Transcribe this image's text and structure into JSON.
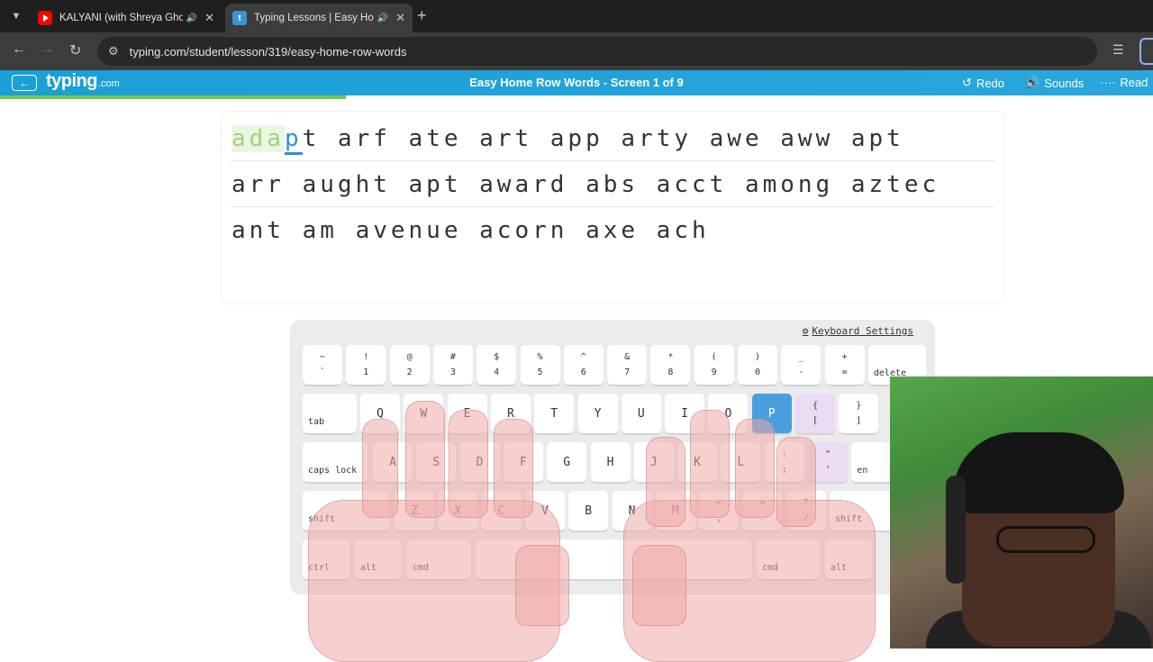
{
  "browser": {
    "tabs": [
      {
        "title": "KALYANI (with Shreya Ghoshal)",
        "favicon": "youtube-icon"
      },
      {
        "title": "Typing Lessons | Easy Home Row Words",
        "favicon": "typing-com-icon"
      }
    ],
    "url": "typing.com/student/lesson/319/easy-home-row-words"
  },
  "header": {
    "logo": "typing",
    "logo_suffix": ".com",
    "title": "Easy Home Row Words - Screen 1 of 9",
    "actions": [
      "Redo",
      "Sounds",
      "Read"
    ],
    "progress_fraction": 0.3
  },
  "lesson": {
    "typed": "ada",
    "current": "p",
    "line1_rest": "t arf ate art app arty awe aww apt",
    "line2": "arr aught apt award abs acct among aztec",
    "line3": "ant am avenue acorn axe ach"
  },
  "keyboard": {
    "settings_label": "Keyboard Settings",
    "active_key": "P",
    "row1": [
      {
        "top": "~",
        "bottom": "`"
      },
      {
        "top": "!",
        "bottom": "1"
      },
      {
        "top": "@",
        "bottom": "2"
      },
      {
        "top": "#",
        "bottom": "3"
      },
      {
        "top": "$",
        "bottom": "4"
      },
      {
        "top": "%",
        "bottom": "5"
      },
      {
        "top": "^",
        "bottom": "6"
      },
      {
        "top": "&",
        "bottom": "7"
      },
      {
        "top": "*",
        "bottom": "8"
      },
      {
        "top": "(",
        "bottom": "9"
      },
      {
        "top": ")",
        "bottom": "0"
      },
      {
        "top": "_",
        "bottom": "-"
      },
      {
        "top": "+",
        "bottom": "="
      }
    ],
    "delete": "delete",
    "tab": "tab",
    "row2": [
      "Q",
      "W",
      "E",
      "R",
      "T",
      "Y",
      "U",
      "I",
      "O",
      "P"
    ],
    "row2_sym": [
      {
        "top": "{",
        "bottom": "["
      },
      {
        "top": "}",
        "bottom": "]"
      }
    ],
    "caps": "caps lock",
    "row3": [
      "A",
      "S",
      "D",
      "F",
      "G",
      "H",
      "J",
      "K",
      "L"
    ],
    "row3_sym": [
      {
        "top": ":",
        "bottom": ";"
      },
      {
        "top": "\"",
        "bottom": "'"
      }
    ],
    "enter": "en",
    "shift": "shift",
    "row4": [
      "Z",
      "X",
      "C",
      "V",
      "B",
      "N",
      "M"
    ],
    "row4_sym": [
      {
        "top": "<",
        "bottom": ","
      },
      {
        "top": ">",
        "bottom": "."
      },
      {
        "top": "?",
        "bottom": "/"
      }
    ],
    "ctrl": "ctrl",
    "alt": "alt",
    "cmd": "cmd",
    "cmd_r": "cmd",
    "alt_r": "alt"
  }
}
